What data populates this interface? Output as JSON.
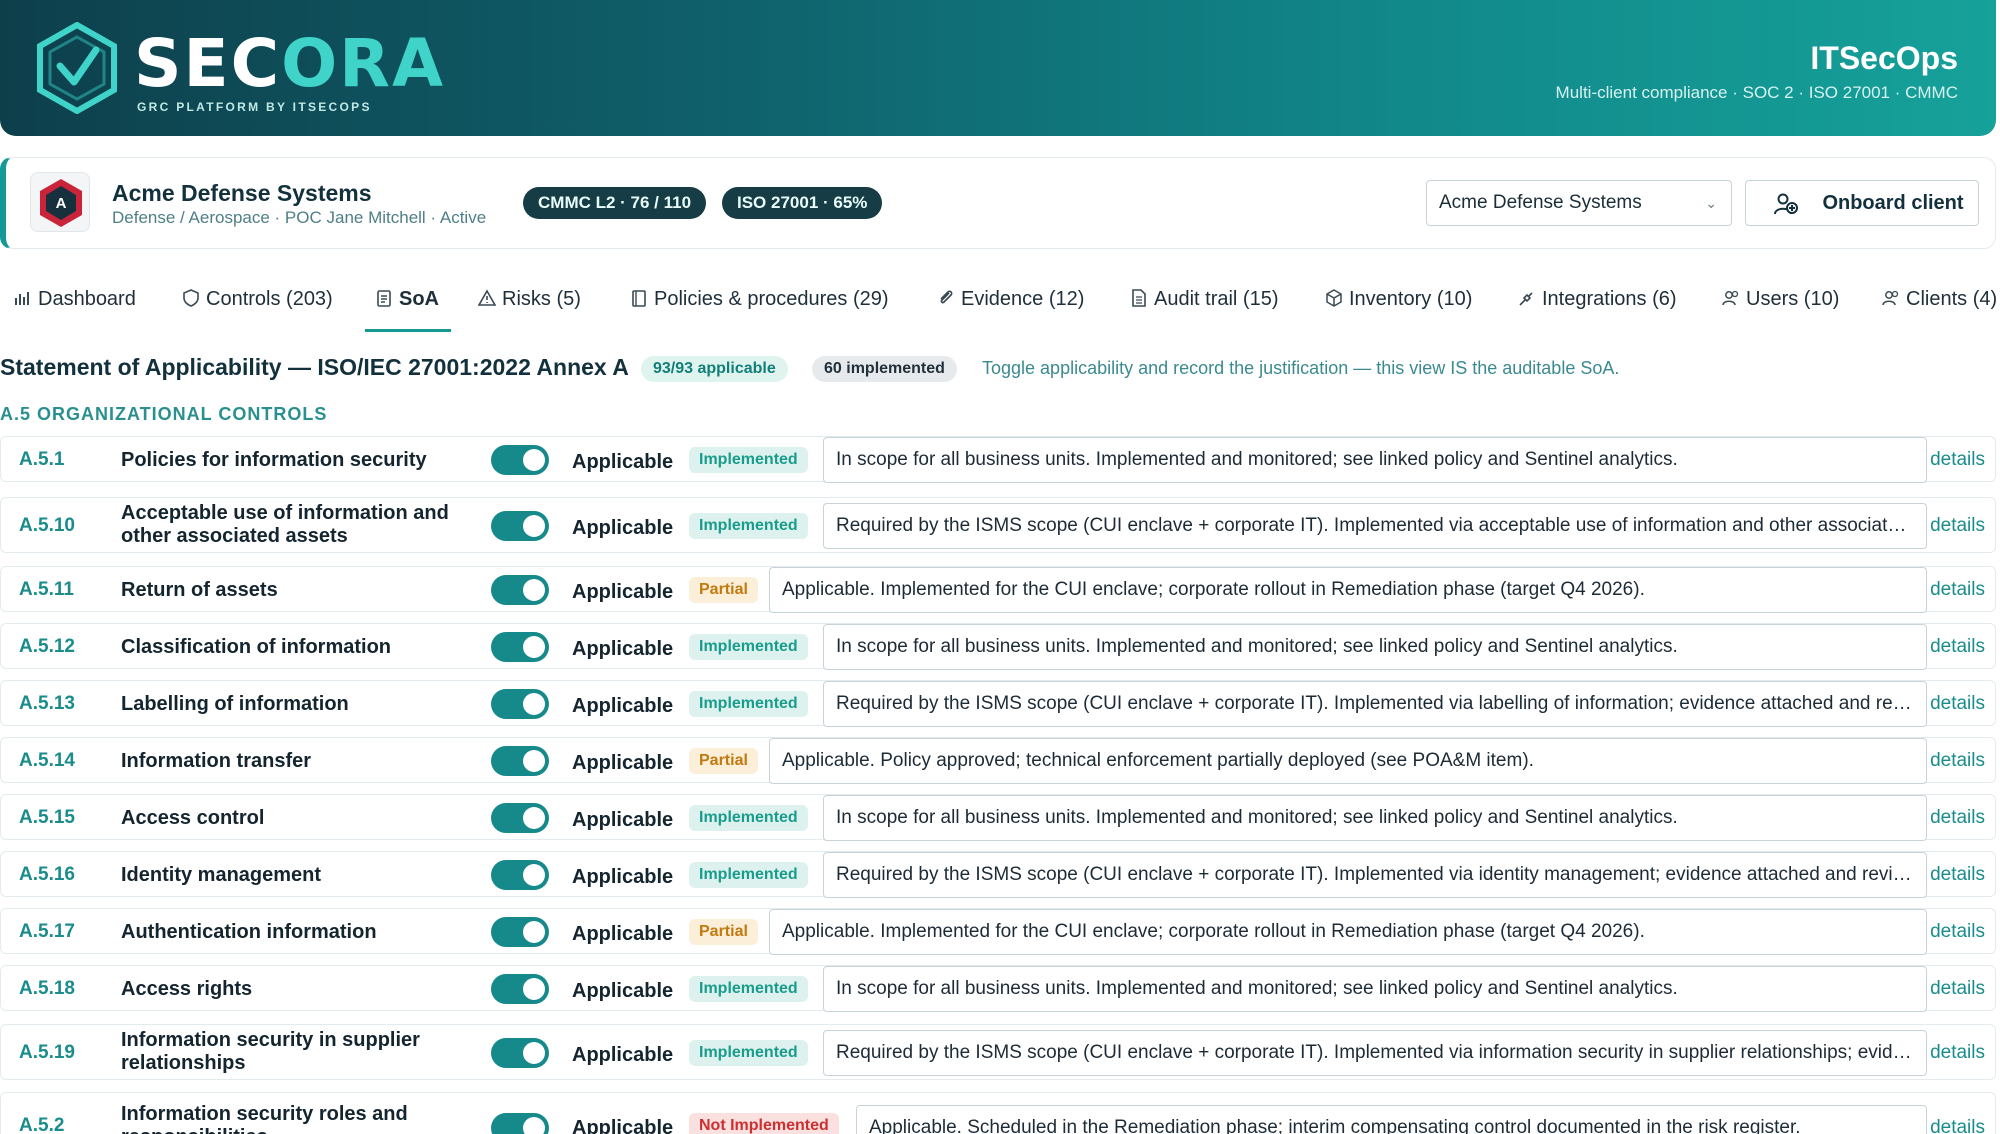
{
  "brand": {
    "logo_main": "SEC",
    "logo_accent": "ORA",
    "logo_sub": "GRC PLATFORM BY ITSECOPS",
    "company": "ITSecOps",
    "tagline": "Multi-client compliance · SOC 2 · ISO 27001 · CMMC"
  },
  "client": {
    "avatar_letter": "A",
    "name": "Acme Defense Systems",
    "meta": "Defense / Aerospace · POC Jane Mitchell · Active",
    "badges": [
      "CMMC L2 · 76 / 110",
      "ISO 27001 · 65%"
    ],
    "selected": "Acme Defense Systems",
    "onboard_label": "Onboard client"
  },
  "tabs": [
    {
      "label": "Dashboard",
      "icon": "bar-chart-icon"
    },
    {
      "label": "Controls (203)",
      "icon": "shield-icon"
    },
    {
      "label": "SoA",
      "icon": "clipboard-icon",
      "active": true
    },
    {
      "label": "Risks (5)",
      "icon": "warning-icon"
    },
    {
      "label": "Policies & procedures (29)",
      "icon": "book-icon"
    },
    {
      "label": "Evidence (12)",
      "icon": "paperclip-icon"
    },
    {
      "label": "Audit trail (15)",
      "icon": "document-icon"
    },
    {
      "label": "Inventory (10)",
      "icon": "box-icon"
    },
    {
      "label": "Integrations (6)",
      "icon": "plug-icon"
    },
    {
      "label": "Users (10)",
      "icon": "users-icon"
    },
    {
      "label": "Clients (4)",
      "icon": "users-icon"
    }
  ],
  "soa": {
    "title": "Statement of Applicability — ISO/IEC 27001:2022 Annex A",
    "applicable_badge": "93/93 applicable",
    "implemented_badge": "60 implemented",
    "hint": "Toggle applicability and record the justification — this view IS the auditable SoA.",
    "section": "A.5 ORGANIZATIONAL CONTROLS",
    "applicable_label": "Applicable",
    "details_label": "details"
  },
  "rows": [
    {
      "id": "A.5.1",
      "name": "Policies for information security",
      "status": "Implemented",
      "justification": "In scope for all business units. Implemented and monitored; see linked policy and Sentinel analytics."
    },
    {
      "id": "A.5.10",
      "name": "Acceptable use of information and other associated assets",
      "status": "Implemented",
      "justification": "Required by the ISMS scope (CUI enclave + corporate IT). Implemented via acceptable use of information and other associated assets; evidence attached and reviewed."
    },
    {
      "id": "A.5.11",
      "name": "Return of assets",
      "status": "Partial",
      "justification": "Applicable. Implemented for the CUI enclave; corporate rollout in Remediation phase (target Q4 2026)."
    },
    {
      "id": "A.5.12",
      "name": "Classification of information",
      "status": "Implemented",
      "justification": "In scope for all business units. Implemented and monitored; see linked policy and Sentinel analytics."
    },
    {
      "id": "A.5.13",
      "name": "Labelling of information",
      "status": "Implemented",
      "justification": "Required by the ISMS scope (CUI enclave + corporate IT). Implemented via labelling of information; evidence attached and reviewed."
    },
    {
      "id": "A.5.14",
      "name": "Information transfer",
      "status": "Partial",
      "justification": "Applicable. Policy approved; technical enforcement partially deployed (see POA&M item)."
    },
    {
      "id": "A.5.15",
      "name": "Access control",
      "status": "Implemented",
      "justification": "In scope for all business units. Implemented and monitored; see linked policy and Sentinel analytics."
    },
    {
      "id": "A.5.16",
      "name": "Identity management",
      "status": "Implemented",
      "justification": "Required by the ISMS scope (CUI enclave + corporate IT). Implemented via identity management; evidence attached and reviewed."
    },
    {
      "id": "A.5.17",
      "name": "Authentication information",
      "status": "Partial",
      "justification": "Applicable. Implemented for the CUI enclave; corporate rollout in Remediation phase (target Q4 2026)."
    },
    {
      "id": "A.5.18",
      "name": "Access rights",
      "status": "Implemented",
      "justification": "In scope for all business units. Implemented and monitored; see linked policy and Sentinel analytics."
    },
    {
      "id": "A.5.19",
      "name": "Information security in supplier relationships",
      "status": "Implemented",
      "justification": "Required by the ISMS scope (CUI enclave + corporate IT). Implemented via information security in supplier relationships; evidence attached and reviewed."
    },
    {
      "id": "A.5.2",
      "name": "Information security roles and responsibilities",
      "status": "Not Implemented",
      "justification": "Applicable. Scheduled in the Remediation phase; interim compensating control documented in the risk register."
    }
  ]
}
